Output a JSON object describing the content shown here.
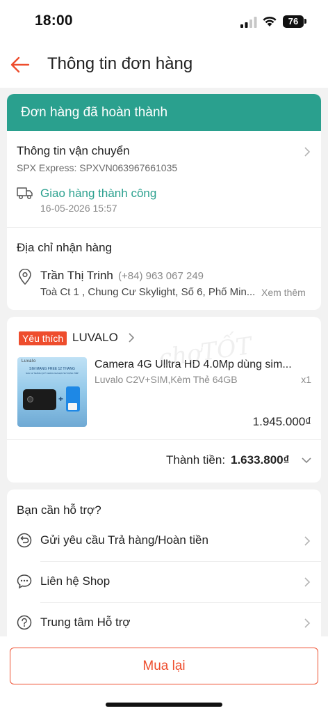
{
  "status_bar": {
    "time": "18:00",
    "battery": "76"
  },
  "nav": {
    "title": "Thông tin đơn hàng"
  },
  "order_status": {
    "banner": "Đơn hàng đã hoàn thành"
  },
  "shipping": {
    "title": "Thông tin vận chuyển",
    "carrier": "SPX Express: SPXVN063967661035",
    "status": "Giao hàng thành công",
    "status_color": "#2aa08e",
    "timestamp": "16-05-2026 15:57"
  },
  "address": {
    "title": "Địa chỉ nhận hàng",
    "name": "Trần Thị Trinh",
    "phone": "(+84) 963 067 249",
    "line": "Toà Ct 1 , Chung Cư Skylight, Số 6, Phố Min...",
    "see_more": "Xem thêm"
  },
  "shop": {
    "badge": "Yêu thích",
    "name": "LUVALO",
    "product": {
      "image_brand": "Luvalo",
      "image_banner": "SIM MẠNG FREE 12 THÁNG",
      "image_caption": "SAU 12 THÁNG QUÝ KHÁCH GIA HẠN SỬ DỤNG TIẾP",
      "title": "Camera 4G Ulltra HD 4.0Mp dùng sim...",
      "variant": "Luvalo C2V+SIM,Kèm Thẻ 64GB",
      "quantity": "x1",
      "price": "1.945.000₫"
    },
    "total_label": "Thành tiền:",
    "total_value": "1.633.800₫"
  },
  "support": {
    "title": "Bạn cần hỗ trợ?",
    "items": [
      {
        "label": "Gửi yêu cầu Trả hàng/Hoàn tiền",
        "icon": "return-icon"
      },
      {
        "label": "Liên hệ Shop",
        "icon": "chat-icon"
      },
      {
        "label": "Trung tâm Hỗ trợ",
        "icon": "help-icon"
      }
    ]
  },
  "actions": {
    "buy_again": "Mua lại"
  },
  "watermark": "chợTỐT",
  "colors": {
    "accent": "#ee4d2d",
    "success": "#2aa08e"
  }
}
